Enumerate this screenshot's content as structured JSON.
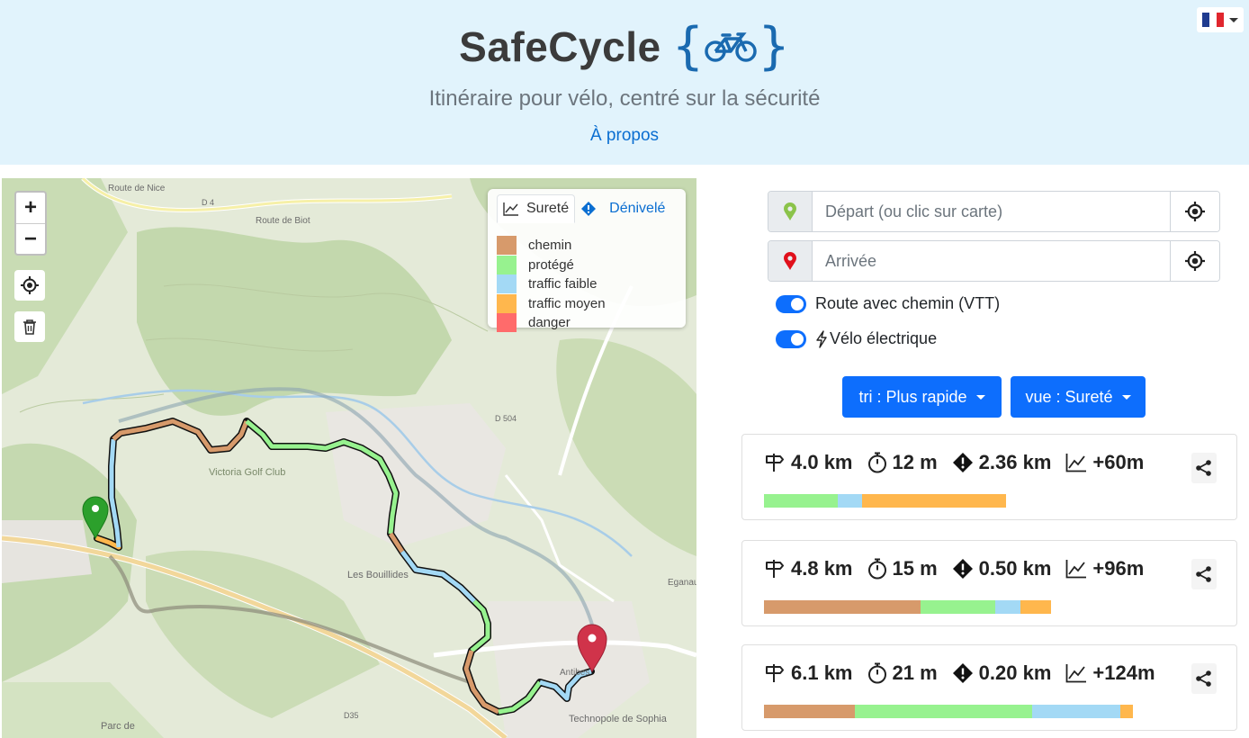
{
  "header": {
    "title": "SafeCycle",
    "brace_open": "{",
    "brace_close": "}",
    "subtitle": "Itinéraire pour vélo, centré sur la sécurité",
    "about_link": "À propos",
    "language_flag": "flag-fr-icon"
  },
  "map": {
    "zoom_in": "+",
    "zoom_out": "−",
    "legend": {
      "tab_safety": "Sureté",
      "tab_elevation": "Dénivelé",
      "items": [
        {
          "label": "chemin",
          "color": "#d79a6b"
        },
        {
          "label": "protégé",
          "color": "#97f28f"
        },
        {
          "label": "traffic faible",
          "color": "#a3d9f5"
        },
        {
          "label": "traffic moyen",
          "color": "#ffb74d"
        },
        {
          "label": "danger",
          "color": "#ff6b6b"
        }
      ]
    },
    "labels": [
      "Route de Nice",
      "Route de Biot",
      "Victoria Golf Club",
      "Les Bouillides",
      "Technopole de Sophia",
      "Parc de",
      "Eganaude",
      "Antibes",
      "D 4",
      "D 504",
      "D35"
    ]
  },
  "form": {
    "start_placeholder": "Départ (ou clic sur carte)",
    "end_placeholder": "Arrivée",
    "toggle_mtb_label": "Route avec chemin (VTT)",
    "toggle_ebike_label": "Vélo électrique",
    "sort_button": "tri : Plus rapide",
    "view_button": "vue : Sureté"
  },
  "routes": [
    {
      "distance": "4.0 km",
      "time": "12 m",
      "danger": "2.36 km",
      "elevation": "+60m",
      "safety_fractions": [
        {
          "color": "#97f28f",
          "fraction": 0.305
        },
        {
          "color": "#a3d9f5",
          "fraction": 0.1
        },
        {
          "color": "#ffb74d",
          "fraction": 0.595
        }
      ],
      "bar_fraction": 0.505
    },
    {
      "distance": "4.8 km",
      "time": "15 m",
      "danger": "0.50 km",
      "elevation": "+96m",
      "safety_fractions": [
        {
          "color": "#d79a6b",
          "fraction": 0.547
        },
        {
          "color": "#97f28f",
          "fraction": 0.258
        },
        {
          "color": "#a3d9f5",
          "fraction": 0.088
        },
        {
          "color": "#ffb74d",
          "fraction": 0.107
        }
      ],
      "bar_fraction": 0.6
    },
    {
      "distance": "6.1 km",
      "time": "21 m",
      "danger": "0.20 km",
      "elevation": "+124m",
      "safety_fractions": [
        {
          "color": "#d79a6b",
          "fraction": 0.247
        },
        {
          "color": "#97f28f",
          "fraction": 0.48
        },
        {
          "color": "#a3d9f5",
          "fraction": 0.24
        },
        {
          "color": "#ffb74d",
          "fraction": 0.033
        }
      ],
      "bar_fraction": 0.77
    }
  ]
}
